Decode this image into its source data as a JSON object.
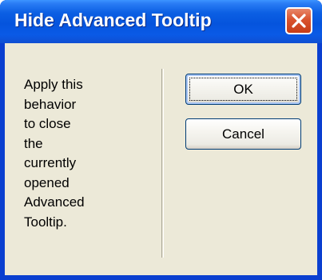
{
  "window": {
    "title": "Hide Advanced Tooltip"
  },
  "titlebar": {
    "close_icon": "close-x-icon"
  },
  "content": {
    "description": "Apply this\nbehavior\nto close\nthe\ncurrently\nopened\nAdvanced\nTooltip."
  },
  "buttons": {
    "ok_label": "OK",
    "cancel_label": "Cancel"
  },
  "colors": {
    "titlebar": "#0554dd",
    "close_button": "#d9532e",
    "dialog_background": "#ece9d8",
    "default_button_border": "#003c74"
  }
}
